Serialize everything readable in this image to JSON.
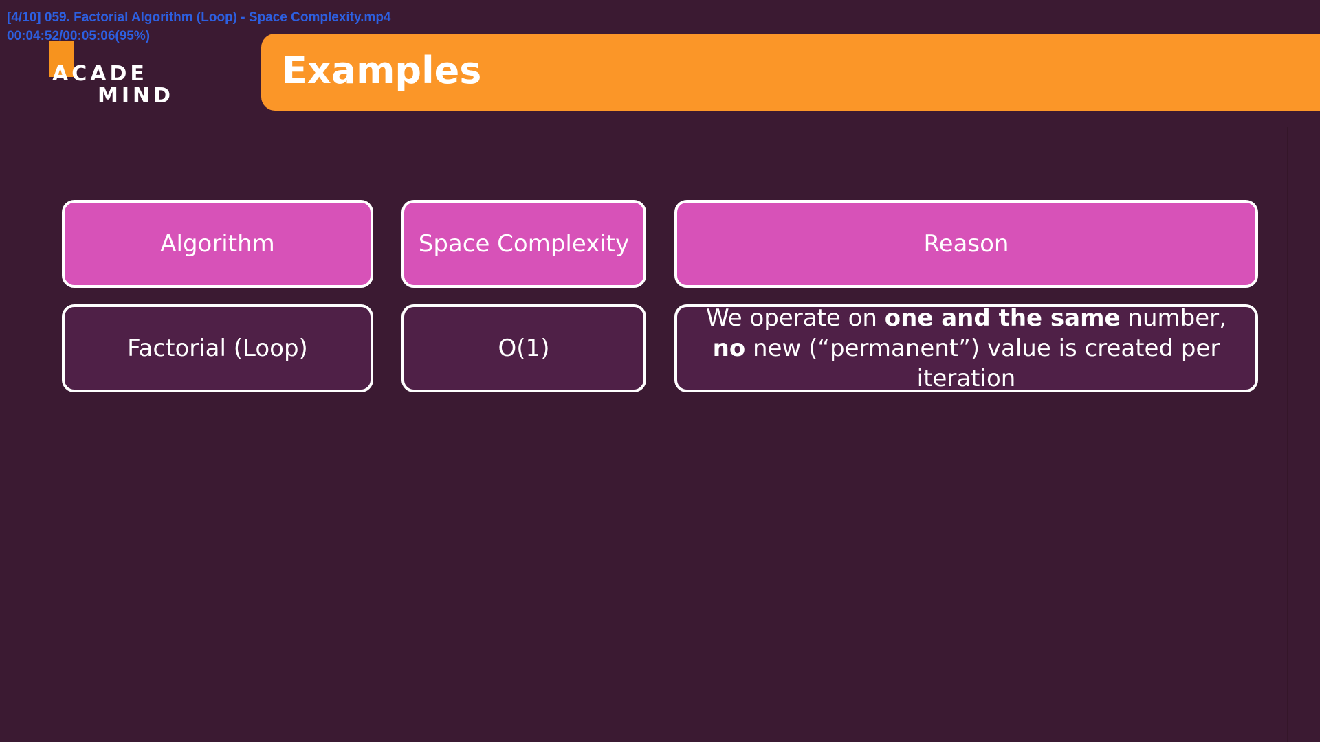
{
  "overlay": {
    "file_line": "[4/10] 059. Factorial Algorithm (Loop) - Space Complexity.mp4",
    "time_line": "00:04:52/00:05:06(95%)"
  },
  "logo": {
    "line1": "ACADE",
    "line2": "MIND"
  },
  "header": {
    "title": "Examples"
  },
  "table": {
    "headers": [
      "Algorithm",
      "Space Complexity",
      "Reason"
    ],
    "rows": [
      {
        "algorithm": "Factorial (Loop)",
        "space_complexity": "O(1)",
        "reason": {
          "part1": "We operate on ",
          "bold1": "one and the same",
          "part2": " number, ",
          "bold2": "no",
          "part3": " new (“permanent”) value is created per iteration"
        }
      }
    ]
  },
  "colors": {
    "background": "#3b1a32",
    "banner": "#fb9628",
    "header_cell": "#d752b8",
    "body_cell": "#4f2047",
    "overlay_text": "#2d5fe0"
  }
}
